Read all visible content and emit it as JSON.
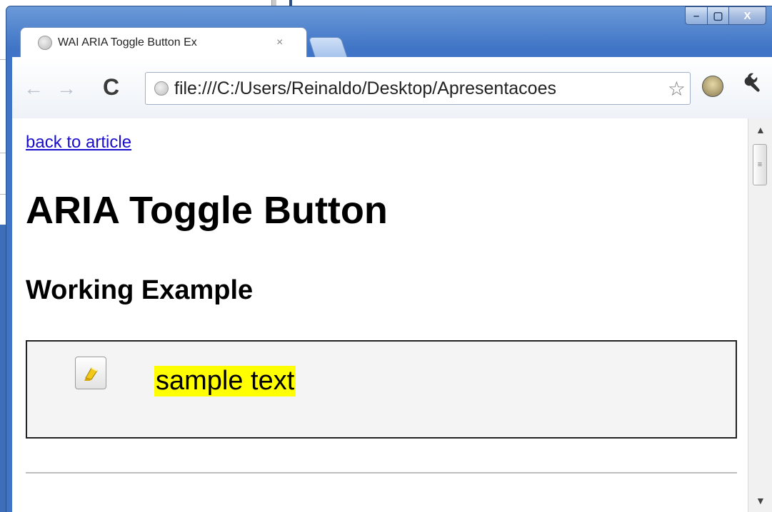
{
  "browser": {
    "tab_title": "WAI ARIA Toggle Button Ex",
    "tab_close": "×",
    "url": "file:///C:/Users/Reinaldo/Desktop/Apresentacoes",
    "window_controls": {
      "minimize": "–",
      "maximize": "▢",
      "close": "X"
    },
    "nav": {
      "back": "←",
      "forward": "→",
      "reload": "C",
      "star": "☆",
      "wrench": "🔧"
    }
  },
  "page": {
    "back_link": "back to article",
    "heading": "ARIA Toggle Button",
    "subheading": "Working Example",
    "sample_text": "sample text"
  },
  "scrollbar": {
    "up": "▲",
    "down": "▼",
    "grip": "≡"
  },
  "colors": {
    "highlight": "#ffff00",
    "link": "#1a0dcc",
    "window_frame": "#3f74c6"
  },
  "icons": {
    "toggle": "highlighter-icon",
    "tab": "globe-icon",
    "omnibox": "globe-icon",
    "extension": "face-extension-icon"
  }
}
